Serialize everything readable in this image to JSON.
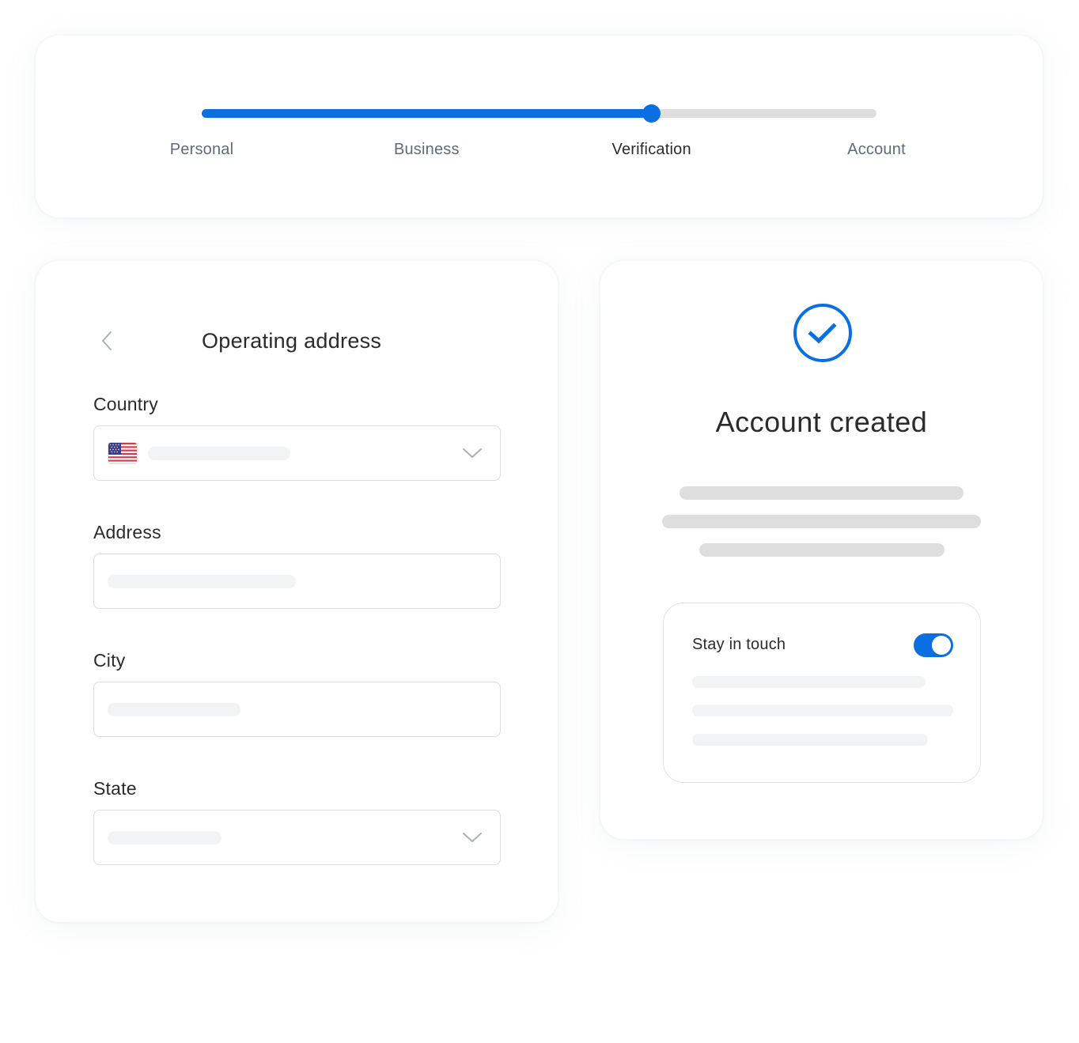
{
  "stepper": {
    "progress_percent": 66.7,
    "current_step_index": 2,
    "steps": [
      {
        "label": "Personal"
      },
      {
        "label": "Business"
      },
      {
        "label": "Verification"
      },
      {
        "label": "Account"
      }
    ],
    "colors": {
      "active": "#0a6fe0",
      "track": "#dedede"
    }
  },
  "address_form": {
    "title": "Operating address",
    "back_icon": "chevron-left-icon",
    "fields": [
      {
        "label": "Country",
        "type": "select",
        "value": "",
        "icon": "us-flag-icon"
      },
      {
        "label": "Address",
        "type": "text",
        "value": ""
      },
      {
        "label": "City",
        "type": "text",
        "value": ""
      },
      {
        "label": "State",
        "type": "select",
        "value": ""
      }
    ]
  },
  "success": {
    "icon": "check-circle-icon",
    "title": "Account created",
    "accent": "#0a6fe0",
    "preferences": {
      "title": "Stay in touch",
      "toggle_on": true
    }
  }
}
